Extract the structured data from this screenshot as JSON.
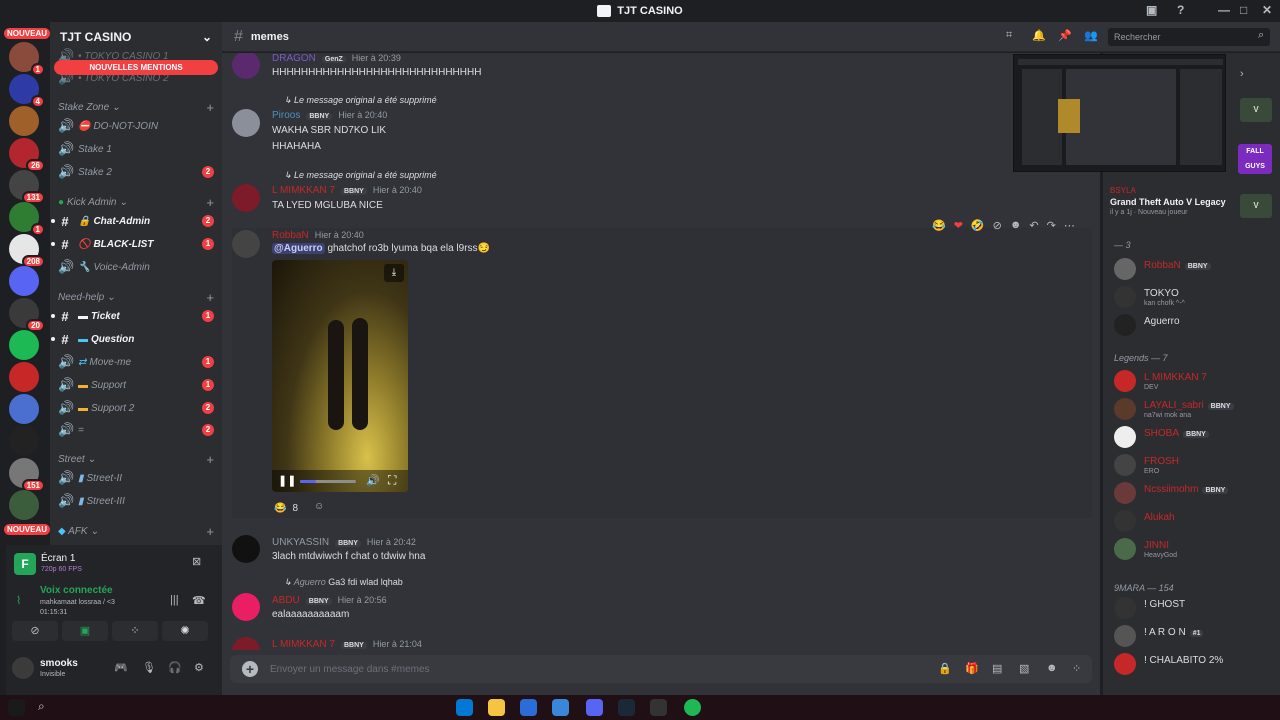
{
  "window": {
    "title": "TJT CASINO"
  },
  "rail": {
    "nouveau_top": "NOUVEAU",
    "nouveau_bottom": "NOUVEAU",
    "guilds": [
      {
        "color": "#8a4b3c",
        "badge": "1"
      },
      {
        "color": "#2e3ba6",
        "badge": "4"
      },
      {
        "color": "#a0602a",
        "badge": ""
      },
      {
        "color": "#b3262d",
        "badge": "26"
      },
      {
        "color": "#444",
        "badge": "131"
      },
      {
        "color": "#2e7d32",
        "badge": "1"
      },
      {
        "color": "#e6e6e6",
        "badge": "208"
      },
      {
        "color": "#5865f2",
        "badge": ""
      },
      {
        "color": "#3a3a3a",
        "badge": "20"
      },
      {
        "color": "#1db954",
        "badge": ""
      },
      {
        "color": "#c62828",
        "badge": ""
      },
      {
        "color": "#4a6fd1",
        "badge": ""
      },
      {
        "color": "#222",
        "badge": ""
      },
      {
        "color": "#777",
        "badge": "151"
      },
      {
        "color": "#3b5d3b",
        "badge": ""
      }
    ]
  },
  "sidebar": {
    "server_name": "TJT CASINO",
    "new_mentions": "NOUVELLES MENTIONS",
    "hidden_top": [
      "• TOKYO CASINO 1",
      "• TOKYO CASINO 2"
    ],
    "categories": [
      {
        "name": "Stake Zone"
      },
      {
        "name": "Kick Admin"
      },
      {
        "name": "Need-help"
      },
      {
        "name": "Street"
      },
      {
        "name": "AFK"
      }
    ],
    "channels": {
      "donotjoin": "DO-NOT-JOIN",
      "stake1": "Stake 1",
      "stake2": "Stake 2",
      "stake2_badge": "2",
      "chat_admin": "Chat-Admin",
      "chat_admin_badge": "2",
      "blacklist": "BLACK-LIST",
      "blacklist_badge": "1",
      "voice_admin": "Voice-Admin",
      "ticket": "Ticket",
      "ticket_badge": "1",
      "question": "Question",
      "moveme": "Move-me",
      "moveme_badge": "1",
      "support": "Support",
      "support_badge": "1",
      "support2": "Support 2",
      "support2_badge": "2",
      "equals": "=",
      "equals_badge": "2",
      "street2": "Street-II",
      "street3": "Street-III"
    }
  },
  "voice": {
    "screen_title": "Écran 1",
    "screen_quality": "720p 60 FPS",
    "status": "Voix connectée",
    "channel": "mahkamaat lossraa / <3",
    "timer": "01:15:31"
  },
  "user": {
    "name": "smooks",
    "status": "Invisible"
  },
  "header": {
    "channel": "memes",
    "search_placeholder": "Rechercher"
  },
  "messages": {
    "m1": {
      "name": "DRAGON",
      "role": "GenZ",
      "time": "Hier à 20:39",
      "text": "HHHHHHHHHHHHHHHHHHHHHHHHHHHHH",
      "avatar": "#5b2a6e",
      "color": "#7a5bc7"
    },
    "m2": {
      "reply": "Le message original a été supprimé",
      "name": "Piroos",
      "role": "BBNY",
      "time": "Hier à 20:40",
      "lines": [
        "WAKHA SBR ND7KO LIK",
        "HHAHAHA"
      ],
      "avatar": "#8a8f99",
      "color": "#4f8fbf"
    },
    "m3": {
      "reply": "Le message original a été supprimé",
      "name": "L MIMKKAN 7",
      "role": "BBNY",
      "time": "Hier à 20:40",
      "text": "TA LYED MGLUBA NICE",
      "avatar": "#7d1b2a",
      "color": "#c62828"
    },
    "m4": {
      "name": "RobbaN",
      "time": "Hier à 20:40",
      "mention": "@Aguerro",
      "text": "ghatchof ro3b lyuma bqa ela l9rss",
      "emoji": "😏",
      "reaction_count": "8",
      "avatar": "#444",
      "color": "#c62828"
    },
    "m5": {
      "name": "UNKYASSIN",
      "role": "BBNY",
      "time": "Hier à 20:42",
      "text": "3lach mtdwiwch f chat o tdwiw hna",
      "avatar": "#111",
      "color": "#949ba4"
    },
    "m6": {
      "reply_name": "Aguerro",
      "reply_text": "Ga3 fdi wlad lqhab",
      "name": "ABDU",
      "role": "BBNY",
      "time": "Hier à 20:56",
      "text": "ealaaaaaaaaaam",
      "avatar": "#e91e63",
      "color": "#c62828"
    },
    "m7": {
      "name": "L MIMKKAN 7",
      "role": "BBNY",
      "time": "Hier à 21:04",
      "avatar": "#7d1b2a",
      "color": "#c62828"
    }
  },
  "composer": {
    "placeholder": "Envoyer un message dans #memes"
  },
  "members": {
    "activity_user": "BSYLA",
    "activity_game": "Grand Theft Auto V Legacy",
    "activity_sub": "il y a 1j",
    "activity_new": "Nouveau joueur",
    "cat_top": "— 3",
    "cat_legends": "Legends — 7",
    "cat_9mara": "9MARA — 154",
    "list_top": [
      {
        "name": "RobbaN",
        "role": "BBNY",
        "status": "",
        "color": "#c62828",
        "avatar": "#666"
      },
      {
        "name": "TOKYO",
        "role": "",
        "status": "kan chofk ^-^",
        "color": "#dbdee1",
        "avatar": "#333"
      },
      {
        "name": "Aguerro",
        "role": "",
        "status": "",
        "color": "#dbdee1",
        "avatar": "#222"
      }
    ],
    "list_legends": [
      {
        "name": "L MIMKKAN 7",
        "role": "",
        "status": "DEV",
        "color": "#c62828",
        "avatar": "#c62828"
      },
      {
        "name": "LAYALI_sabri",
        "role": "BBNY",
        "status": "na7wi mok ana",
        "color": "#c62828",
        "avatar": "#5a3a2a"
      },
      {
        "name": "SHOBA",
        "role": "BBNY",
        "status": "",
        "color": "#c62828",
        "avatar": "#eee"
      },
      {
        "name": "FROSH",
        "role": "",
        "status": "ERO",
        "color": "#c62828",
        "avatar": "#444"
      },
      {
        "name": "Ncssiimohm",
        "role": "BBNY",
        "status": "",
        "color": "#c62828",
        "avatar": "#6a3a3a"
      },
      {
        "name": "Alukah",
        "role": "",
        "status": "",
        "color": "#c62828",
        "avatar": "#333"
      },
      {
        "name": "JINNI",
        "role": "",
        "status": "HeavyGod",
        "color": "#c62828",
        "avatar": "#4a6a4a"
      }
    ],
    "list_9mara": [
      {
        "name": "! GHOST",
        "role": "",
        "status": "",
        "color": "#dbdee1",
        "avatar": "#333"
      },
      {
        "name": "! A R O N",
        "role": "#1",
        "status": "",
        "color": "#dbdee1",
        "avatar": "#555"
      },
      {
        "name": "! CHALABITO 2%",
        "role": "",
        "status": "",
        "color": "#dbdee1",
        "avatar": "#c62828"
      }
    ]
  },
  "colors": {
    "accent": "#5865f2",
    "danger": "#f23f42",
    "online": "#23a55a"
  }
}
